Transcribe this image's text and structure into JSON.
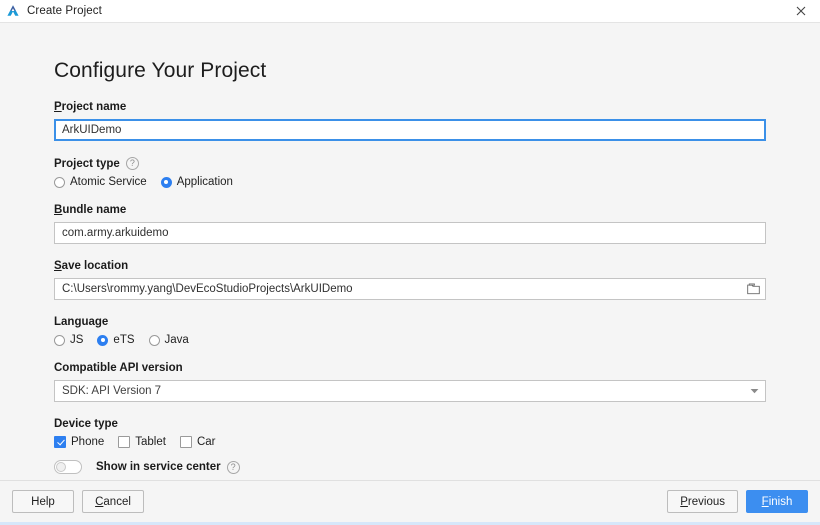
{
  "window": {
    "title": "Create Project",
    "logo_icon": "deveco-studio-logo-icon",
    "close_icon": "close-icon"
  },
  "page": {
    "heading": "Configure Your Project"
  },
  "fields": {
    "project_name": {
      "label_mnemonic": "P",
      "label_rest": "roject name",
      "value": "ArkUIDemo",
      "focused": true
    },
    "project_type": {
      "label": "Project type",
      "help_icon": "help-circle-icon",
      "options": [
        {
          "label": "Atomic Service",
          "selected": false
        },
        {
          "label": "Application",
          "selected": true
        }
      ]
    },
    "bundle_name": {
      "label_mnemonic": "B",
      "label_rest": "undle name",
      "value": "com.army.arkuidemo"
    },
    "save_location": {
      "label_mnemonic": "S",
      "label_rest": "ave location",
      "value": "C:\\Users\\rommy.yang\\DevEcoStudioProjects\\ArkUIDemo",
      "browse_icon": "folder-icon"
    },
    "language": {
      "label": "Language",
      "options": [
        {
          "label": "JS",
          "selected": false
        },
        {
          "label": "eTS",
          "selected": true
        },
        {
          "label": "Java",
          "selected": false
        }
      ]
    },
    "compatible_api_version": {
      "label": "Compatible API version",
      "value": "SDK: API Version 7",
      "arrow_icon": "chevron-down-icon"
    },
    "device_type": {
      "label": "Device type",
      "options": [
        {
          "label": "Phone",
          "checked": true
        },
        {
          "label": "Tablet",
          "checked": false
        },
        {
          "label": "Car",
          "checked": false
        }
      ]
    },
    "show_in_service_center": {
      "label": "Show in service center",
      "enabled": false,
      "help_icon": "help-circle-icon"
    }
  },
  "footer": {
    "help": "Help",
    "cancel_mnemonic": "C",
    "cancel_rest": "ancel",
    "previous_mnemonic": "P",
    "previous_rest": "revious",
    "finish_mnemonic": "F",
    "finish_rest": "inish"
  },
  "colors": {
    "accent": "#2d7ff0",
    "primary_button": "#3c8ef0",
    "focus_border": "#3b90e8",
    "background": "#f5f5f5"
  }
}
